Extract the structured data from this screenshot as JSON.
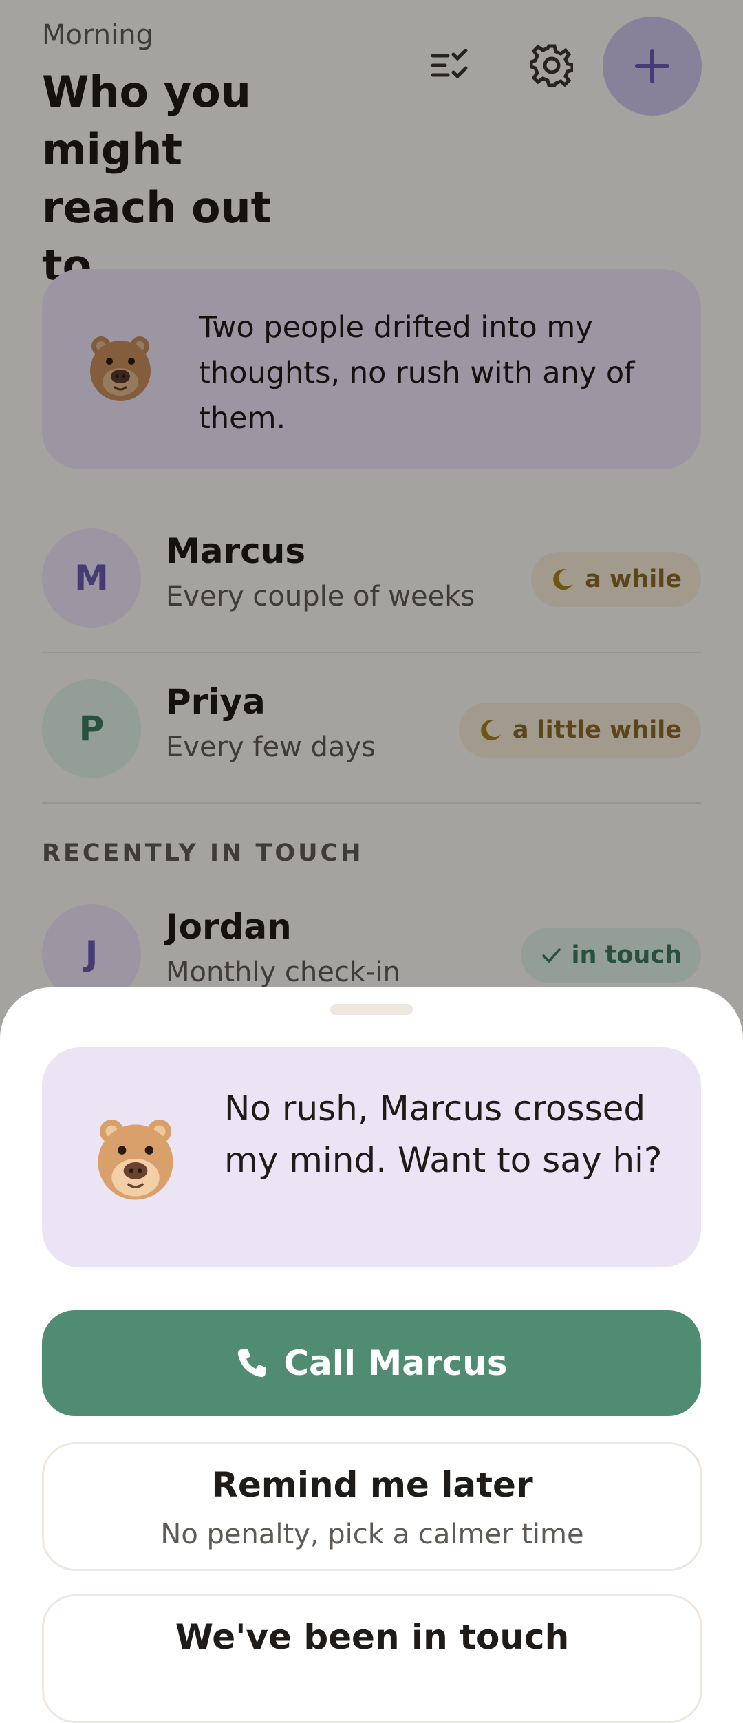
{
  "header": {
    "greeting": "Morning",
    "title": "Who you might reach out to"
  },
  "intro_card": {
    "message": "Two people drifted into my thoughts, no rush with any of them."
  },
  "contacts": [
    {
      "initial": "M",
      "name": "Marcus",
      "frequency": "Every couple of weeks",
      "status": "a while",
      "status_icon": "moon-icon"
    },
    {
      "initial": "P",
      "name": "Priya",
      "frequency": "Every few days",
      "status": "a little while",
      "status_icon": "moon-icon"
    }
  ],
  "recent": {
    "label": "RECENTLY IN TOUCH",
    "contacts": [
      {
        "initial": "J",
        "name": "Jordan",
        "frequency": "Monthly check-in",
        "status": "in touch",
        "status_icon": "check-icon"
      }
    ]
  },
  "sheet": {
    "message": "No rush, Marcus crossed my mind. Want to say hi?",
    "call_label": "Call Marcus",
    "remind_title": "Remind me later",
    "remind_subtitle": "No penalty, pick a calmer time",
    "touch_label": "We've been in touch"
  },
  "colors": {
    "accent_purple": "#6b5bb0",
    "call_green": "#4f8c71",
    "card_lavender": "#ebe4f5",
    "badge_warm": "#f6ecd6",
    "badge_green": "#dff0e7"
  },
  "icons": [
    "checklist-icon",
    "gear-icon",
    "plus-icon",
    "bear-icon",
    "moon-icon",
    "check-icon",
    "phone-icon"
  ]
}
